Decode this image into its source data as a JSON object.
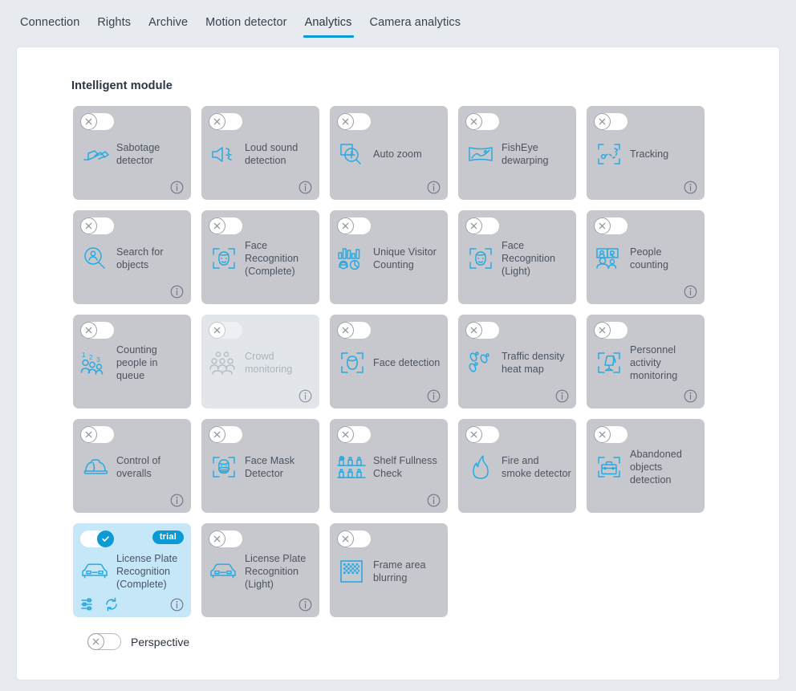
{
  "tabs": [
    {
      "label": "Connection",
      "active": false
    },
    {
      "label": "Rights",
      "active": false
    },
    {
      "label": "Archive",
      "active": false
    },
    {
      "label": "Motion detector",
      "active": false
    },
    {
      "label": "Analytics",
      "active": true
    },
    {
      "label": "Camera analytics",
      "active": false
    }
  ],
  "section": {
    "title": "Intelligent module"
  },
  "colors": {
    "accent": "#0a9ad6",
    "icon_blue": "#29a9e1",
    "card_bg": "#c6c8cd",
    "card_active_bg": "#c5e7f7",
    "card_disabled_bg": "#e2e6eb",
    "page_bg": "#e7eaee",
    "panel_bg": "#ffffff",
    "text": "#4a5462"
  },
  "cards": [
    {
      "label": "Sabotage detector",
      "icon": "sabotage-detector-icon",
      "toggle": "off",
      "state": "enabled",
      "info": true,
      "badge": null,
      "actions": []
    },
    {
      "label": "Loud sound detection",
      "icon": "loud-sound-icon",
      "toggle": "off",
      "state": "enabled",
      "info": true,
      "badge": null,
      "actions": []
    },
    {
      "label": "Auto zoom",
      "icon": "auto-zoom-icon",
      "toggle": "off",
      "state": "enabled",
      "info": true,
      "badge": null,
      "actions": []
    },
    {
      "label": "FishEye dewarping",
      "icon": "fisheye-dewarping-icon",
      "toggle": "off",
      "state": "enabled",
      "info": false,
      "badge": null,
      "actions": []
    },
    {
      "label": "Tracking",
      "icon": "tracking-icon",
      "toggle": "off",
      "state": "enabled",
      "info": true,
      "badge": null,
      "actions": []
    },
    {
      "label": "Search for objects",
      "icon": "search-objects-icon",
      "toggle": "off",
      "state": "enabled",
      "info": true,
      "badge": null,
      "actions": []
    },
    {
      "label": "Face Recognition (Complete)",
      "icon": "face-recognition-icon",
      "toggle": "off",
      "state": "enabled",
      "info": false,
      "badge": null,
      "actions": []
    },
    {
      "label": "Unique Visitor Counting",
      "icon": "unique-visitor-counting-icon",
      "toggle": "off",
      "state": "enabled",
      "info": false,
      "badge": null,
      "actions": []
    },
    {
      "label": "Face Recognition (Light)",
      "icon": "face-recognition-icon",
      "toggle": "off",
      "state": "enabled",
      "info": false,
      "badge": null,
      "actions": []
    },
    {
      "label": "People counting",
      "icon": "people-counting-icon",
      "toggle": "off",
      "state": "enabled",
      "info": true,
      "badge": null,
      "actions": []
    },
    {
      "label": "Counting people in queue",
      "icon": "counting-people-queue-icon",
      "toggle": "off",
      "state": "enabled",
      "info": false,
      "badge": null,
      "actions": []
    },
    {
      "label": "Crowd monitoring",
      "icon": "crowd-monitoring-icon",
      "toggle": "off",
      "state": "disabled",
      "info": true,
      "badge": null,
      "actions": []
    },
    {
      "label": "Face detection",
      "icon": "face-detection-icon",
      "toggle": "off",
      "state": "enabled",
      "info": true,
      "badge": null,
      "actions": []
    },
    {
      "label": "Traffic density heat map",
      "icon": "traffic-heatmap-icon",
      "toggle": "off",
      "state": "enabled",
      "info": true,
      "badge": null,
      "actions": []
    },
    {
      "label": "Personnel activity monitoring",
      "icon": "personnel-activity-icon",
      "toggle": "off",
      "state": "enabled",
      "info": true,
      "badge": null,
      "actions": []
    },
    {
      "label": "Control of overalls",
      "icon": "hard-hat-icon",
      "toggle": "off",
      "state": "enabled",
      "info": true,
      "badge": null,
      "actions": []
    },
    {
      "label": "Face Mask Detector",
      "icon": "face-mask-icon",
      "toggle": "off",
      "state": "enabled",
      "info": false,
      "badge": null,
      "actions": []
    },
    {
      "label": "Shelf Fullness Check",
      "icon": "shelf-fullness-icon",
      "toggle": "off",
      "state": "enabled",
      "info": true,
      "badge": null,
      "actions": []
    },
    {
      "label": "Fire and smoke detector",
      "icon": "fire-smoke-icon",
      "toggle": "off",
      "state": "enabled",
      "info": false,
      "badge": null,
      "actions": []
    },
    {
      "label": "Abandoned objects detection",
      "icon": "abandoned-objects-icon",
      "toggle": "off",
      "state": "enabled",
      "info": false,
      "badge": null,
      "actions": []
    },
    {
      "label": "License Plate Recognition (Complete)",
      "icon": "license-plate-icon",
      "toggle": "on",
      "state": "active",
      "info": true,
      "badge": "trial",
      "actions": [
        "settings-sliders-icon",
        "refresh-icon"
      ]
    },
    {
      "label": "License Plate Recognition (Light)",
      "icon": "license-plate-icon",
      "toggle": "off",
      "state": "enabled",
      "info": true,
      "badge": null,
      "actions": []
    },
    {
      "label": "Frame area blurring",
      "icon": "frame-blur-icon",
      "toggle": "off",
      "state": "enabled",
      "info": false,
      "badge": null,
      "actions": []
    }
  ],
  "perspective": {
    "label": "Perspective",
    "toggle": "off"
  }
}
